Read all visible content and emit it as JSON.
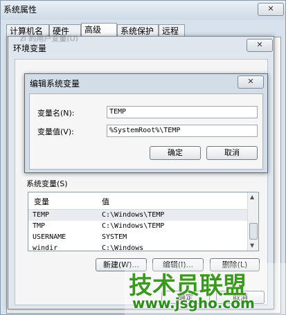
{
  "system_properties": {
    "title": "系统属性",
    "close_glyph": "✕",
    "tabs": [
      "计算机名",
      "硬件",
      "高级",
      "系统保护",
      "远程"
    ],
    "active_tab": "高级"
  },
  "env_vars": {
    "title": "环境变量",
    "close_glyph": "✕",
    "user_vars_label_faded": "zl 的用户变量(U)",
    "system_vars_label": "系统变量(S)",
    "columns": {
      "name": "变量",
      "value": "值"
    },
    "rows": [
      {
        "name": "TEMP",
        "value": "C:\\Windows\\TEMP"
      },
      {
        "name": "TMP",
        "value": "C:\\Windows\\TEMP"
      },
      {
        "name": "USERNAME",
        "value": "SYSTEM"
      },
      {
        "name": "windir",
        "value": "C:\\Windows"
      }
    ],
    "buttons": {
      "new": "新建(W)...",
      "edit": "编辑(I)...",
      "delete": "删除(L)"
    },
    "ok_partial": "确定",
    "cancel_partial": "取消"
  },
  "edit_dialog": {
    "title": "编辑系统变量",
    "close_glyph": "✕",
    "name_label": "变量名(N):",
    "value_label": "变量值(V):",
    "name_value": "TEMP",
    "value_value": "%SystemRoot%\\TEMP",
    "ok_label": "确定",
    "cancel_label": "取消"
  },
  "watermark": {
    "text": "技术员联盟",
    "url": "www.jsgho.com"
  }
}
